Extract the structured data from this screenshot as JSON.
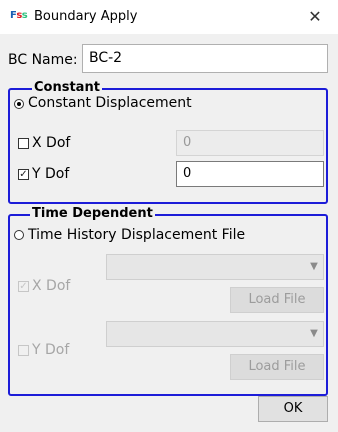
{
  "window": {
    "title": "Boundary Apply",
    "icon_letters": [
      "F",
      "s",
      "s"
    ],
    "icon": "fss-app-icon",
    "close_glyph": "✕",
    "close_icon": "close-icon"
  },
  "bc_name": {
    "label": "BC Name:",
    "value": "BC-2"
  },
  "constant": {
    "legend": "Constant",
    "radio_label": "Constant Displacement",
    "radio_checked": true,
    "x_dof": {
      "label": "X Dof",
      "checked": false,
      "value": "0",
      "enabled": false
    },
    "y_dof": {
      "label": "Y Dof",
      "checked": true,
      "value": "0",
      "enabled": true
    }
  },
  "time_dependent": {
    "legend": "Time Dependent",
    "radio_label": "Time History Displacement File",
    "radio_checked": false,
    "x_dof": {
      "label": "X Dof",
      "checked": true,
      "file": "",
      "load_label": "Load File",
      "enabled": false
    },
    "y_dof": {
      "label": "Y Dof",
      "checked": false,
      "file": "",
      "load_label": "Load File",
      "enabled": false
    }
  },
  "ok_label": "OK",
  "glyphs": {
    "check": "✓",
    "dropdown": "▼"
  }
}
